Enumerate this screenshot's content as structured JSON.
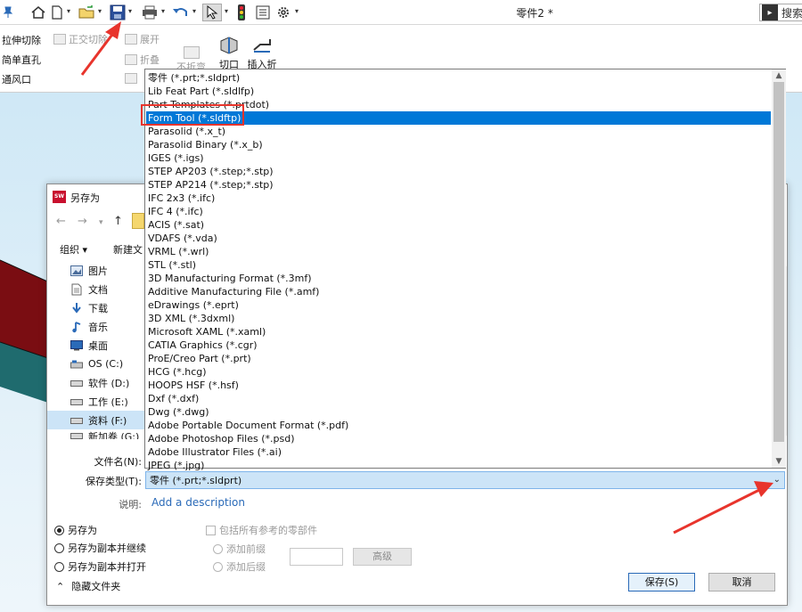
{
  "titlebar": {
    "doc_title": "零件2 *",
    "search_label": "搜索"
  },
  "ribbon": {
    "left_commands": [
      "拉伸切除",
      "简单直孔",
      "通风口"
    ],
    "gray_commands": [
      "正交切除",
      "展开",
      "折叠",
      "不折弯"
    ],
    "big_commands": [
      "切口",
      "插入折弯"
    ]
  },
  "dialog": {
    "title": "另存为",
    "command_bar": {
      "organize": "组织 ▾",
      "new_folder": "新建文"
    },
    "tree": [
      {
        "label": "图片",
        "icon": "pictures-icon"
      },
      {
        "label": "文档",
        "icon": "documents-icon"
      },
      {
        "label": "下载",
        "icon": "download-icon"
      },
      {
        "label": "音乐",
        "icon": "music-icon"
      },
      {
        "label": "桌面",
        "icon": "desktop-icon"
      },
      {
        "label": "OS (C:)",
        "icon": "drive-icon"
      },
      {
        "label": "软件 (D:)",
        "icon": "drive-icon"
      },
      {
        "label": "工作 (E:)",
        "icon": "drive-icon"
      },
      {
        "label": "资料 (F:)",
        "icon": "drive-icon",
        "selected": true
      },
      {
        "label": "新加卷 (G:)",
        "icon": "drive-icon"
      }
    ],
    "filename_label": "文件名(N):",
    "filetype_label": "保存类型(T):",
    "filetype_value": "零件 (*.prt;*.sldprt)",
    "description_label": "说明:",
    "description_link": "Add a description",
    "save_options": [
      {
        "label": "另存为",
        "checked": true
      },
      {
        "label": "另存为副本并继续",
        "checked": false
      },
      {
        "label": "另存为副本并打开",
        "checked": false
      }
    ],
    "include_refs": "包括所有参考的零部件",
    "prefix_options": [
      "添加前缀",
      "添加后缀"
    ],
    "advanced_btn": "高级",
    "hide_folders": "隐藏文件夹",
    "save_btn": "保存(S)",
    "cancel_btn": "取消"
  },
  "file_types": [
    "零件 (*.prt;*.sldprt)",
    "Lib Feat Part (*.sldlfp)",
    "Part Templates (*.prtdot)",
    "Form Tool (*.sldftp)",
    "Parasolid (*.x_t)",
    "Parasolid Binary (*.x_b)",
    "IGES (*.igs)",
    "STEP AP203 (*.step;*.stp)",
    "STEP AP214 (*.step;*.stp)",
    "IFC 2x3 (*.ifc)",
    "IFC 4 (*.ifc)",
    "ACIS (*.sat)",
    "VDAFS (*.vda)",
    "VRML (*.wrl)",
    "STL (*.stl)",
    "3D Manufacturing Format (*.3mf)",
    "Additive Manufacturing File (*.amf)",
    "eDrawings (*.eprt)",
    "3D XML (*.3dxml)",
    "Microsoft XAML (*.xaml)",
    "CATIA Graphics (*.cgr)",
    "ProE/Creo Part (*.prt)",
    "HCG (*.hcg)",
    "HOOPS HSF (*.hsf)",
    "Dxf (*.dxf)",
    "Dwg (*.dwg)",
    "Adobe Portable Document Format (*.pdf)",
    "Adobe Photoshop Files (*.psd)",
    "Adobe Illustrator Files (*.ai)",
    "JPEG (*.jpg)"
  ],
  "selected_file_type_index": 3,
  "colors": {
    "accent": "#0078d7",
    "annotation": "#e8342c",
    "model_dark_red": "#7a0d12",
    "model_teal": "#1f6b6e"
  }
}
